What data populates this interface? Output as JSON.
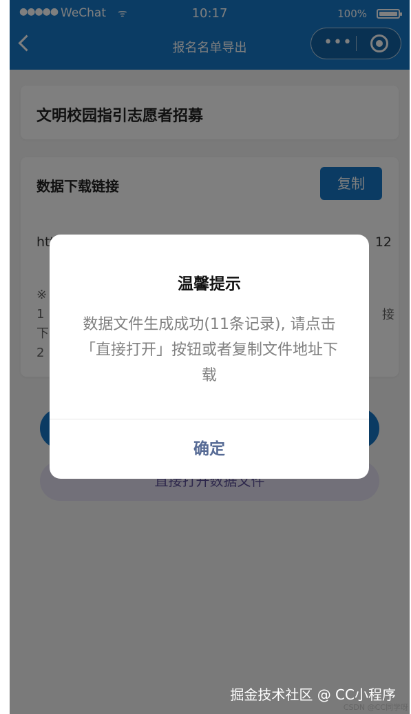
{
  "status_bar": {
    "signal": "●●●●●",
    "carrier": "WeChat",
    "wifi": "ᯤ",
    "time": "10:17",
    "battery_percent": "100%"
  },
  "nav": {
    "title": "报名名单导出",
    "more": "•••"
  },
  "card_title": "文明校园指引志愿者招募",
  "download": {
    "title": "数据下载链接",
    "copy_label": "复制",
    "url_start": "htt",
    "url_end": "12",
    "note_lines": [
      "※",
      "1",
      "下",
      "2"
    ],
    "note_right": "接"
  },
  "buttons": {
    "primary_label": "",
    "open_label": "直接打开数据文件"
  },
  "dialog": {
    "title": "温馨提示",
    "message": "数据文件生成成功(11条记录), 请点击「直接打开」按钮或者复制文件地址下载",
    "confirm_label": "确定"
  },
  "watermark": "掘金技术社区 @ CC小程序",
  "csdn": "CSDN @CC同学呀",
  "colors": {
    "nav_blue": "#1678c8",
    "button_blue": "#1677c7",
    "dialog_confirm": "#576b95"
  }
}
